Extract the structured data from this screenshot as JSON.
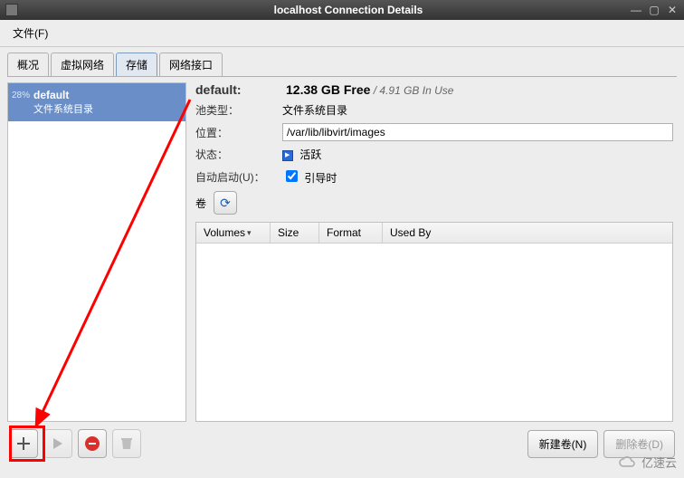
{
  "window": {
    "title": "localhost Connection Details"
  },
  "menu": {
    "file": "文件(F)"
  },
  "tabs": {
    "overview": "概况",
    "virtual_networks": "虚拟网络",
    "storage": "存储",
    "network_interfaces": "网络接口"
  },
  "sidebar": {
    "pool": {
      "pct": "28%",
      "name": "default",
      "subtitle": "文件系统目录"
    }
  },
  "details": {
    "name_label": "default:",
    "free_value": "12.38 GB Free",
    "inuse_value": "/ 4.91 GB In Use",
    "pool_type_label": "池类型：",
    "pool_type_value": "文件系统目录",
    "location_label": "位置：",
    "location_value": "/var/lib/libvirt/images",
    "state_label": "状态：",
    "state_value": "活跃",
    "autostart_label": "自动启动(U)：",
    "autostart_value": "引导时",
    "volumes_label": "卷"
  },
  "table": {
    "col_volumes": "Volumes",
    "col_size": "Size",
    "col_format": "Format",
    "col_usedby": "Used By"
  },
  "buttons": {
    "new_volume": "新建卷(N)",
    "delete_volume": "删除卷(D)"
  },
  "watermark": "亿速云"
}
